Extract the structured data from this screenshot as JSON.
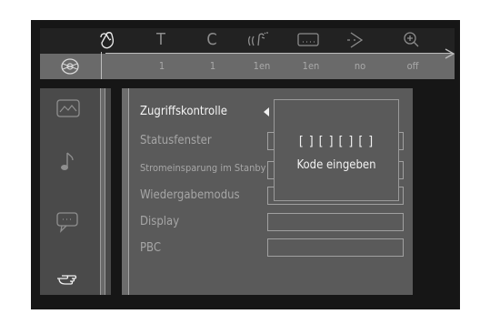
{
  "status_bar": {
    "icons": [
      {
        "name": "title-icon",
        "glyph": "T"
      },
      {
        "name": "chapter-icon",
        "glyph": "C"
      },
      {
        "name": "audio-icon"
      },
      {
        "name": "subtitle-icon"
      },
      {
        "name": "angle-icon"
      },
      {
        "name": "zoom-icon"
      }
    ],
    "values": [
      "1",
      "1",
      "1en",
      "1en",
      "no",
      "off"
    ]
  },
  "sidebar": {
    "icons": [
      "picture-icon",
      "music-note-icon",
      "speech-bubble-icon",
      "pointing-hand-icon"
    ],
    "active": "pointing-hand-icon"
  },
  "menu": {
    "items": [
      {
        "label": "Zugriffskontrolle",
        "active": true
      },
      {
        "label": "Statusfenster",
        "active": false
      },
      {
        "label": "Stromeinsparung im Stanby",
        "active": false
      },
      {
        "label": "Wiedergabemodus",
        "active": false
      },
      {
        "label": "Display",
        "active": false
      },
      {
        "label": "PBC",
        "active": false
      }
    ]
  },
  "popup": {
    "code_slots": "[ ] [ ] [ ] [ ]",
    "label": "Kode eingeben"
  },
  "colors": {
    "background": "#161616",
    "bar_top": "#222222",
    "bar_bottom": "#6a6a6a",
    "panel": "#5a5a5a",
    "sidebar": "#4a4a4a",
    "text_active": "#f5f5f5",
    "text_inactive": "#a6a6a6"
  }
}
